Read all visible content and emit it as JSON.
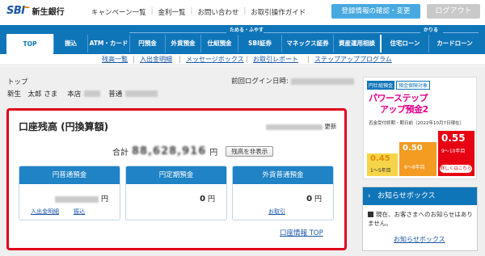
{
  "header": {
    "logo_mark": "SBI",
    "logo_name": "新生銀行",
    "links": [
      "キャンペーン一覧",
      "金利一覧",
      "お問い合わせ",
      "お取引操作ガイド"
    ],
    "register_button": "登録情報の確認・変更",
    "logout_button": "ログアウト"
  },
  "nav": {
    "groups": {
      "tameru": "ためる・ふやす",
      "kariru": "かりる"
    },
    "items": [
      "TOP",
      "振込",
      "ATM・カード",
      "円預金",
      "外貨預金",
      "仕組預金",
      "SBI証券",
      "マネックス証券",
      "資産運用相談",
      "住宅ローン",
      "カードローン"
    ]
  },
  "subnav": [
    "残高一覧",
    "入出金明細",
    "メッセージボックス",
    "お取引レポート",
    "ステップアッププログラム"
  ],
  "breadcrumb": "トップ",
  "last_login_label": "前回ログイン日時:",
  "account": {
    "name": "新生　太郎 さま",
    "branch_label": "本店",
    "type": "普通"
  },
  "balance": {
    "title": "口座残高 (円換算額)",
    "updated_suffix": "更新",
    "total_label": "合計",
    "total_amount": "88,628,916",
    "currency_unit": "円",
    "hide_button": "残高を非表示",
    "cards": [
      {
        "title": "円普通預金",
        "value": "88,628,916",
        "unit": "円",
        "links": [
          "入出金明細",
          "振込"
        ]
      },
      {
        "title": "円定期預金",
        "value": "0",
        "unit": "円",
        "links": []
      },
      {
        "title": "外貨普通預金",
        "value": "0",
        "unit": "円",
        "links": [
          "お取引"
        ]
      }
    ],
    "account_info_link": "口座情報 TOP"
  },
  "promo": {
    "tag1": "円仕組預金",
    "tag2": "預金保険対象",
    "headline1": "パワーステップ",
    "headline2": "アップ預金2",
    "subtext": "否金受付終期・期日前（2022年10月7日現在）",
    "steps": [
      {
        "rate": "0.45",
        "unit": "%",
        "label": "1〜5年目"
      },
      {
        "rate": "0.50",
        "unit": "%",
        "label": "6〜8年目"
      },
      {
        "rate": "0.55",
        "unit": "%",
        "label": "9〜10年目",
        "prefix": "年"
      }
    ],
    "more": "詳しくはこちら"
  },
  "news": {
    "title": "お知らせボックス",
    "text": "現在、お客さまへのお知らせはありません。",
    "link": "お知らせボックス"
  },
  "colors": {
    "brand_blue": "#0f75b9",
    "alert_red": "#e0001b",
    "register_blue": "#47a9e0"
  }
}
